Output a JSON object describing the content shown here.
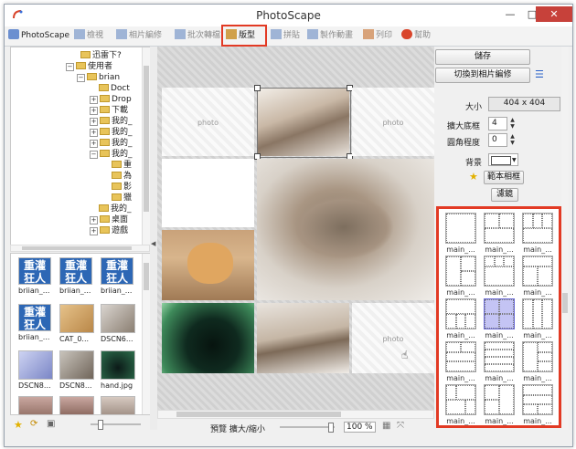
{
  "window": {
    "title": "PhotoScape"
  },
  "tabs": [
    {
      "label": "PhotoScape",
      "active": true
    },
    {
      "label": "檢視",
      "active": false
    },
    {
      "label": "相片編修",
      "active": false
    },
    {
      "label": "批次轉檔",
      "active": false
    },
    {
      "label": "版型",
      "active": true
    },
    {
      "label": "拼貼",
      "active": false
    },
    {
      "label": "製作動畫",
      "active": false
    },
    {
      "label": "列印",
      "active": false
    },
    {
      "label": "幫助",
      "active": false
    }
  ],
  "tree": [
    "迅雷下?",
    "使用者",
    "brian",
    "Doct",
    "Drop",
    "下載",
    "我的_",
    "我的_",
    "我的_",
    "我的_",
    "重",
    "為",
    "影",
    "獵",
    "我的_",
    "桌面",
    "遊戲"
  ],
  "thumbs": [
    {
      "name": "briian_...",
      "kind": "kanji"
    },
    {
      "name": "briian_...",
      "kind": "kanji"
    },
    {
      "name": "briian_...",
      "kind": "kanji"
    },
    {
      "name": "briian_...",
      "kind": "kanji"
    },
    {
      "name": "CAT_0...",
      "kind": "cat"
    },
    {
      "name": "DSCN6...",
      "kind": "cat2"
    },
    {
      "name": "DSCN8...",
      "kind": "lilac"
    },
    {
      "name": "DSCN8...",
      "kind": "cat3"
    },
    {
      "name": "hand.jpg",
      "kind": "hand"
    },
    {
      "name": "",
      "kind": "tree"
    },
    {
      "name": "",
      "kind": "tree"
    },
    {
      "name": "",
      "kind": "tree"
    }
  ],
  "canvas": {
    "kanji_text": "重灌\n狂人",
    "placeholder": "photo",
    "bottom_label": "預覽 擴大/縮小",
    "zoom": "100 %"
  },
  "panel": {
    "save": "儲存",
    "switch_edit": "切換到相片編修",
    "size_label": "大小",
    "size_value": "404 x 404",
    "expand_border_label": "擴大底框",
    "expand_border_value": "4",
    "round_label": "圓角程度",
    "round_value": "0",
    "background_label": "背景",
    "template_button": "範本相框",
    "filter_button": "濾鏡"
  },
  "templates": [
    "main_...",
    "main_...",
    "main_...",
    "main_...",
    "main_...",
    "main_...",
    "main_...",
    "main_...",
    "main_...",
    "main_...",
    "main_...",
    "main_...",
    "main_...",
    "main_...",
    "main_..."
  ],
  "colors": {
    "accent": "#e23a24",
    "selected_template": "#b5b5f2",
    "kanji_blue": "#2d67b5",
    "close": "#c7413a"
  }
}
